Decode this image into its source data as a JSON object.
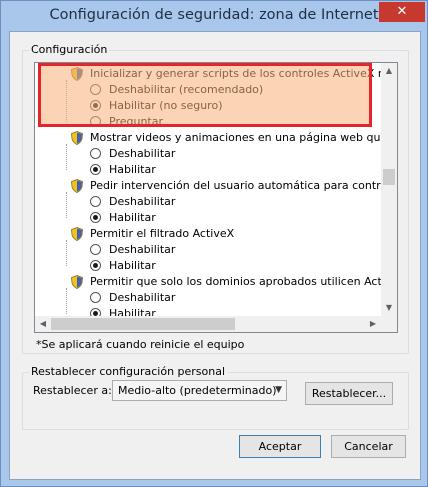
{
  "window": {
    "title": "Configuración de seguridad: zona de Internet",
    "close_glyph": "✕"
  },
  "config_group": {
    "label": "Configuración"
  },
  "settings": [
    {
      "label": "Inicializar y generar scripts de los controles ActiveX no marca",
      "options": [
        {
          "label": "Deshabilitar (recomendado)",
          "checked": false
        },
        {
          "label": "Habilitar (no seguro)",
          "checked": true
        },
        {
          "label": "Preguntar",
          "checked": false
        }
      ]
    },
    {
      "label": "Mostrar videos y animaciones en una página web que no usa",
      "options": [
        {
          "label": "Deshabilitar",
          "checked": false
        },
        {
          "label": "Habilitar",
          "checked": true
        }
      ]
    },
    {
      "label": "Pedir intervención del usuario automática para controles Acti",
      "options": [
        {
          "label": "Deshabilitar",
          "checked": false
        },
        {
          "label": "Habilitar",
          "checked": true
        }
      ]
    },
    {
      "label": "Permitir el filtrado ActiveX",
      "options": [
        {
          "label": "Deshabilitar",
          "checked": false
        },
        {
          "label": "Habilitar",
          "checked": true
        }
      ]
    },
    {
      "label": "Permitir que solo los dominios aprobados utilicen ActiveX sin p",
      "options": [
        {
          "label": "Deshabilitar",
          "checked": false
        },
        {
          "label": "Habilitar",
          "checked": true
        }
      ]
    }
  ],
  "note": "*Se aplicará cuando reinicie el equipo",
  "reset_group": {
    "label": "Restablecer configuración personal",
    "reset_to_label": "Restablecer a:",
    "selected_level": "Medio-alto (predeterminado)",
    "reset_button": "Restablecer..."
  },
  "footer": {
    "ok": "Aceptar",
    "cancel": "Cancelar"
  },
  "colors": {
    "highlight_border": "#e3262d",
    "highlight_fill": "#f5b078",
    "title_bg": "#a9c7ea",
    "close_bg": "#c7392f"
  }
}
